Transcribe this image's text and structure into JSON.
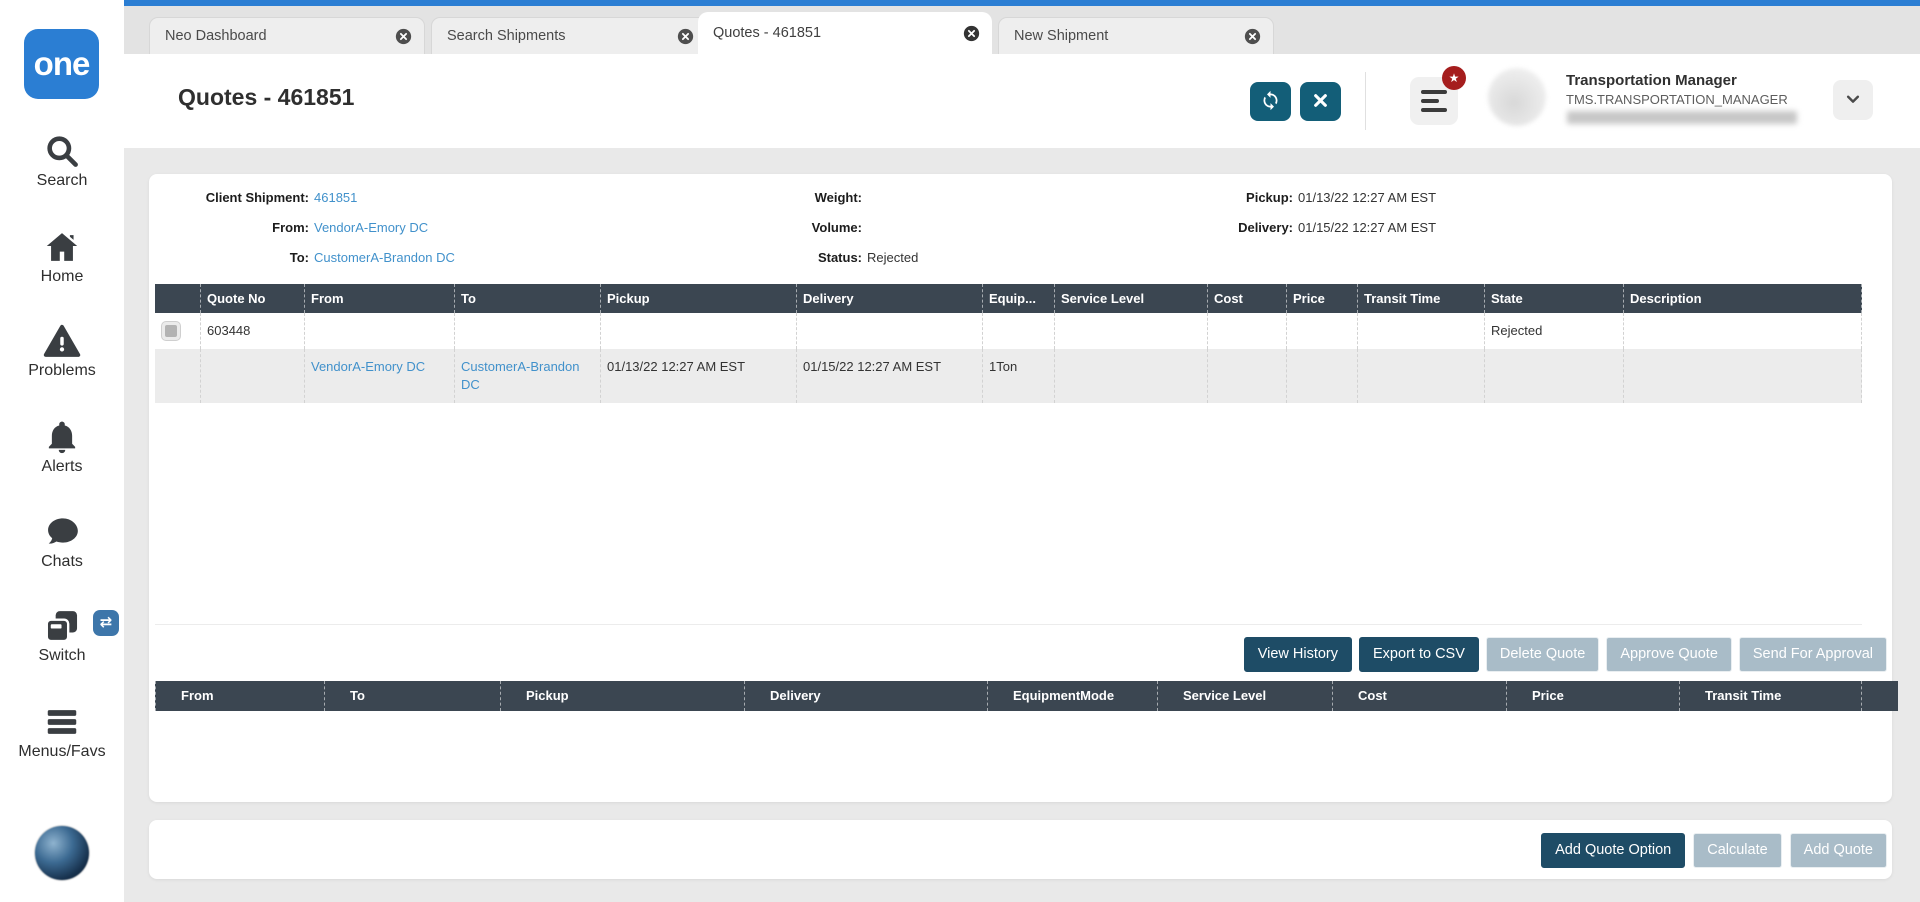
{
  "colors": {
    "accent_blue": "#2b7ed3",
    "link_blue": "#4191cb",
    "teal_button": "#135e78",
    "table_header": "#3b4651",
    "primary_button": "#1e4c66",
    "disabled_button": "#a9bcc8",
    "badge_red": "#a51d1d",
    "row_stripe": "#ececec"
  },
  "icons": {
    "star": "★",
    "switch_badge": "⇄"
  },
  "sidebar": {
    "logo_text": "one",
    "items": [
      {
        "label": "Search"
      },
      {
        "label": "Home"
      },
      {
        "label": "Problems"
      },
      {
        "label": "Alerts"
      },
      {
        "label": "Chats"
      },
      {
        "label": "Switch"
      },
      {
        "label": "Menus/Favs"
      }
    ]
  },
  "tabs": [
    {
      "label": "Neo Dashboard",
      "active": false
    },
    {
      "label": "Search Shipments",
      "active": false
    },
    {
      "label": "Quotes - 461851",
      "active": true
    },
    {
      "label": "New Shipment",
      "active": false
    }
  ],
  "header": {
    "title": "Quotes - 461851",
    "user": {
      "role": "Transportation Manager",
      "role_id": "TMS.TRANSPORTATION_MANAGER"
    }
  },
  "shipment_info": {
    "client_shipment_label": "Client Shipment:",
    "client_shipment_value": "461851",
    "from_label": "From:",
    "from_value": "VendorA-Emory DC",
    "to_label": "To:",
    "to_value": "CustomerA-Brandon DC",
    "weight_label": "Weight:",
    "weight_value": "",
    "volume_label": "Volume:",
    "volume_value": "",
    "status_label": "Status:",
    "status_value": "Rejected",
    "pickup_label": "Pickup:",
    "pickup_value": "01/13/22 12:27 AM EST",
    "delivery_label": "Delivery:",
    "delivery_value": "01/15/22 12:27 AM EST"
  },
  "quotes_table": {
    "columns": [
      "Quote No",
      "From",
      "To",
      "Pickup",
      "Delivery",
      "Equip...",
      "Service Level",
      "Cost",
      "Price",
      "Transit Time",
      "State",
      "Description"
    ],
    "rows": [
      {
        "quote_no": "603448",
        "state": "Rejected"
      },
      {
        "from": "VendorA-Emory DC",
        "to": "CustomerA-Brandon DC",
        "pickup": "01/13/22 12:27 AM EST",
        "delivery": "01/15/22 12:27 AM EST",
        "equip": "1Ton"
      }
    ]
  },
  "quote_actions": [
    {
      "label": "View History",
      "enabled": true
    },
    {
      "label": "Export to CSV",
      "enabled": true
    },
    {
      "label": "Delete Quote",
      "enabled": false
    },
    {
      "label": "Approve Quote",
      "enabled": false
    },
    {
      "label": "Send For Approval",
      "enabled": false
    }
  ],
  "options_table": {
    "columns": [
      "From",
      "To",
      "Pickup",
      "Delivery",
      "EquipmentMode",
      "Service Level",
      "Cost",
      "Price",
      "Transit Time"
    ]
  },
  "footer_actions": [
    {
      "label": "Add Quote Option",
      "enabled": true
    },
    {
      "label": "Calculate",
      "enabled": false
    },
    {
      "label": "Add Quote",
      "enabled": false
    }
  ]
}
